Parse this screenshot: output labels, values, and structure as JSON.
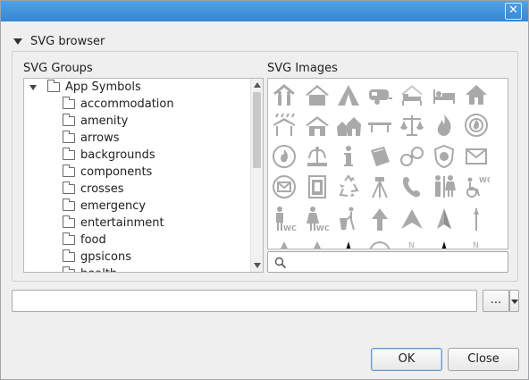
{
  "window": {
    "close_glyph": "✕"
  },
  "section": {
    "title": "SVG browser"
  },
  "groups": {
    "label": "SVG Groups",
    "root": "App Symbols",
    "items": [
      "accommodation",
      "amenity",
      "arrows",
      "backgrounds",
      "components",
      "crosses",
      "emergency",
      "entertainment",
      "food",
      "gpsicons",
      "health"
    ]
  },
  "images": {
    "label": "SVG Images",
    "icons": [
      "house-people-icon",
      "hotel-icon",
      "tent-icon",
      "caravan-icon",
      "house-bed-icon",
      "bed-icon",
      "home-icon",
      "shelter-rain-icon",
      "cabin-icon",
      "two-houses-icon",
      "picnic-table-icon",
      "scales-icon",
      "fire-icon",
      "fire-station-icon",
      "shelter-fire-icon",
      "fountain-icon",
      "information-icon",
      "book-icon",
      "handcuffs-icon",
      "police-badge-icon",
      "mail-icon",
      "mail-circle-icon",
      "phone-booth-icon",
      "recycle-icon",
      "tripod-icon",
      "telephone-icon",
      "toilets-icon",
      "wheelchair-wc-icon",
      "male-wc-icon",
      "female-wc-icon",
      "waste-basket-icon",
      "arrow-up-icon",
      "arrow-northeast-icon",
      "north-arrow-icon",
      "north-needle-icon"
    ]
  },
  "search": {
    "placeholder": "",
    "value": ""
  },
  "path": {
    "value": "",
    "browse_label": "..."
  },
  "buttons": {
    "ok": "OK",
    "close": "Close"
  }
}
